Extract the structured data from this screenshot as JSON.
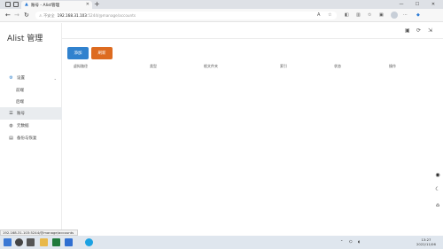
{
  "browser": {
    "tab_title": "账号 - Alist管理",
    "url_warning": "不安全",
    "url_host": "192.168.31.103",
    "url_path": ":5244/@manage/accounts",
    "status_url": "192.168.31.103:5244/@manage/accounts"
  },
  "app": {
    "brand": "Alist 管理",
    "nav": [
      {
        "label": "设置",
        "icon": "gear-icon",
        "glyph": "⚙"
      },
      {
        "label": "前端",
        "sub": true
      },
      {
        "label": "后端",
        "sub": true
      },
      {
        "label": "账号",
        "icon": "list-icon",
        "glyph": "☰",
        "active": true
      },
      {
        "label": "元数据",
        "icon": "globe-icon",
        "glyph": "◍"
      },
      {
        "label": "备份与恢复",
        "icon": "database-icon",
        "glyph": "▤"
      }
    ],
    "buttons": {
      "add": "添加",
      "refresh": "刷新"
    },
    "columns": [
      "虚拟路径",
      "类型",
      "根文件夹",
      "索引",
      "状态",
      "操作"
    ]
  },
  "taskbar": {
    "time": "13:27",
    "date": "2022/11/06"
  },
  "colors": {
    "add": "#3182ce",
    "refresh": "#dd6b20"
  }
}
